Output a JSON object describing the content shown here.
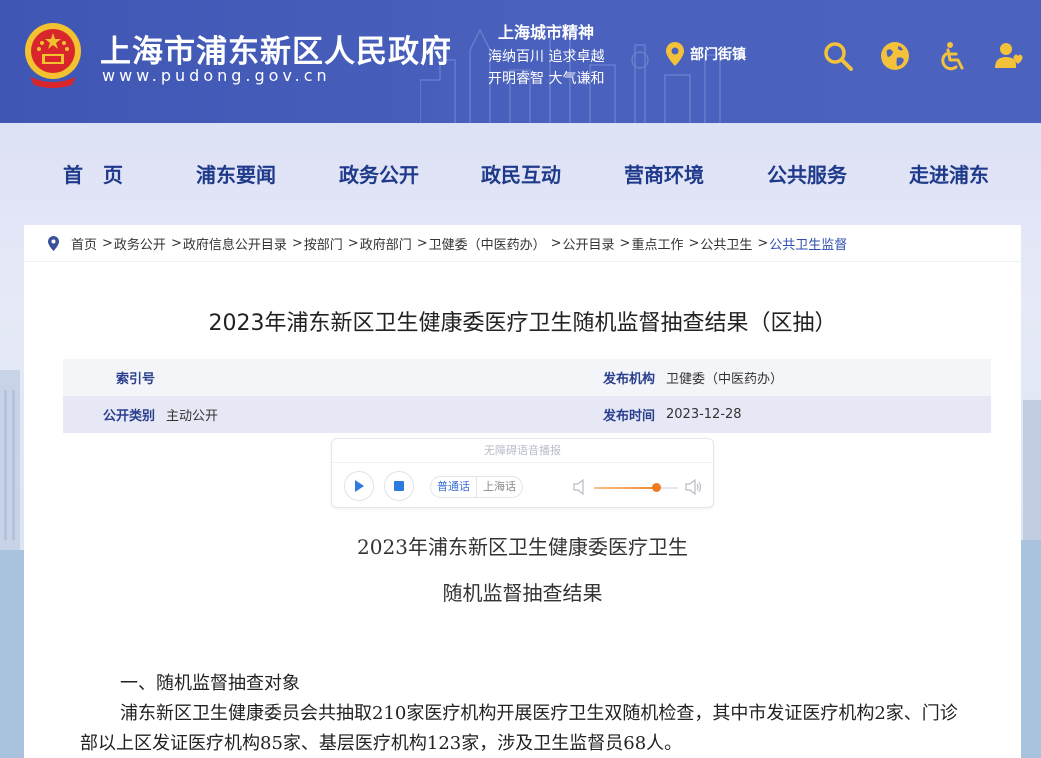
{
  "header": {
    "site_title": "上海市浦东新区人民政府",
    "site_url": "www.pudong.gov.cn",
    "spirit": {
      "title": "上海城市精神",
      "line1": "海纳百川  追求卓越",
      "line2": "开明睿智  大气谦和"
    },
    "location_label": "部门街镇",
    "colors": {
      "header_bg": "#4a62bd",
      "icon_gold": "#f3c23a"
    },
    "icons": [
      "location-pin-icon",
      "search-icon",
      "globe-icon",
      "accessibility-icon",
      "user-icon"
    ]
  },
  "nav": {
    "items": [
      "首　页",
      "浦东要闻",
      "政务公开",
      "政民互动",
      "营商环境",
      "公共服务",
      "走进浦东"
    ]
  },
  "breadcrumb": {
    "items": [
      "首页",
      "政务公开",
      "政府信息公开目录",
      "按部门",
      "政府部门",
      "卫健委（中医药办）",
      "公开目录",
      "重点工作",
      "公共卫生",
      "公共卫生监督"
    ],
    "separator": ">"
  },
  "article": {
    "title": "2023年浦东新区卫生健康委医疗卫生随机监督抽查结果（区抽）",
    "meta": {
      "index_label": "索引号",
      "index_value": "",
      "publisher_label": "发布机构",
      "publisher_value": "卫健委（中医药办）",
      "category_label": "公开类别",
      "category_value": "主动公开",
      "date_label": "发布时间",
      "date_value": "2023-12-28"
    },
    "player": {
      "header": "无障碍语音播报",
      "lang_active": "普通话",
      "lang_other": "上海话",
      "volume": 0.74
    },
    "heading_line1": "2023年浦东新区卫生健康委医疗卫生",
    "heading_line2": "随机监督抽查结果",
    "section1_title": "一、随机监督抽查对象",
    "section1_body": "浦东新区卫生健康委员会共抽取210家医疗机构开展医疗卫生双随机检查，其中市发证医疗机构2家、门诊部以上区发证医疗机构85家、基层医疗机构123家，涉及卫生监督员68人。"
  }
}
